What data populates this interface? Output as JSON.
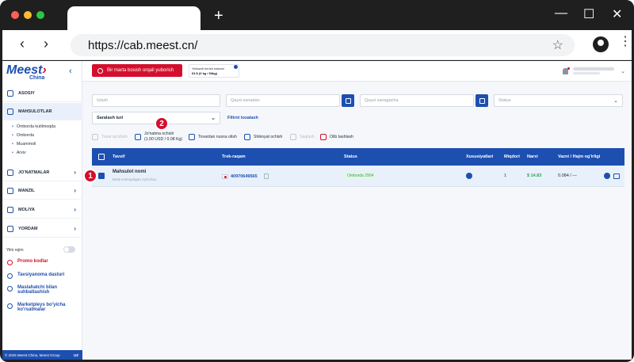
{
  "browser": {
    "url": "https://cab.meest.cn/",
    "new_tab_label": "+",
    "back_glyph": "‹",
    "forward_glyph": "›",
    "star_glyph": "☆",
    "minimize_glyph": "—",
    "maximize_glyph": "☐",
    "close_glyph": "✕",
    "menu_glyph": "⋮"
  },
  "brand": {
    "logo": "Meest",
    "logo_mark": "›",
    "sub": "China",
    "collapse_glyph": "‹"
  },
  "sidebar": {
    "items": [
      {
        "label": "ASOSIY"
      },
      {
        "label": "MAHSULOTLAR"
      },
      {
        "label": "JO'NATMALAR"
      },
      {
        "label": "MANZIL"
      },
      {
        "label": "MOLIYA"
      },
      {
        "label": "YORDAM"
      }
    ],
    "subitems": [
      "Omborda kutilmoqda",
      "Omborda",
      "Muammoli",
      "Arxiv"
    ],
    "toggle_label": "Yilni rejim",
    "links": [
      {
        "label": "Promo kodlar",
        "color": "#d40f2d"
      },
      {
        "label": "Tavsiyanoma dasturi",
        "color": "#1d4fb0"
      },
      {
        "label": "Maslahatchi bilan suhbatlashish",
        "color": "#1d4fb0"
      },
      {
        "label": "Marketpleys bo'yicha ko'rsatmalar",
        "color": "#1d4fb0"
      }
    ],
    "footer": "© 2025 Meest China, Meest Group",
    "lang": "UZ",
    "chevron": "›"
  },
  "topbar": {
    "red_button": "Bir marta bosish orqali yuborish",
    "balance_label": "Yetkazib berish balansi",
    "balance_value": "63 $ (0 kg / 54kg)",
    "dropdown_glyph": "⌄"
  },
  "filters": {
    "search_placeholder": "Izlash",
    "date_from_placeholder": "Qaysi sanadan",
    "date_to_placeholder": "Qaysi sanagacha",
    "status_placeholder": "Status",
    "sort_label": "Saralash turi",
    "reset_label": "Filtrni tozalash"
  },
  "actions": [
    {
      "label": "Tovar qo'shish",
      "disabled": true
    },
    {
      "label": "Jo'natma ochish\n(1.00 USD / 0.08 Kg)",
      "disabled": false
    },
    {
      "label": "Tovardan nusxa olish",
      "disabled": false
    },
    {
      "label": "Shikoyat ochish",
      "disabled": false
    },
    {
      "label": "Saqlash",
      "disabled": true
    },
    {
      "label": "Olib tashlash",
      "disabled": false
    }
  ],
  "table": {
    "headers": [
      "Tavsif",
      "Trek-raqam",
      "Status",
      "Xususiyatlari",
      "Miqdori",
      "Narxi",
      "Vazni / Hajm og'irligi"
    ],
    "rows": [
      {
        "name": "Mahsulot nomi",
        "subtitle": "Beda sotmaydigan o'yinchoq",
        "track": "40970649565",
        "status": "Omborda 2904",
        "qty": "1",
        "price": "$ 14.83",
        "weight": "0.084 / —"
      }
    ]
  },
  "markers": [
    "1",
    "2"
  ],
  "colors": {
    "brand_blue": "#1d4fb0",
    "brand_red": "#d40f2d",
    "success_green": "#3aa35a"
  }
}
